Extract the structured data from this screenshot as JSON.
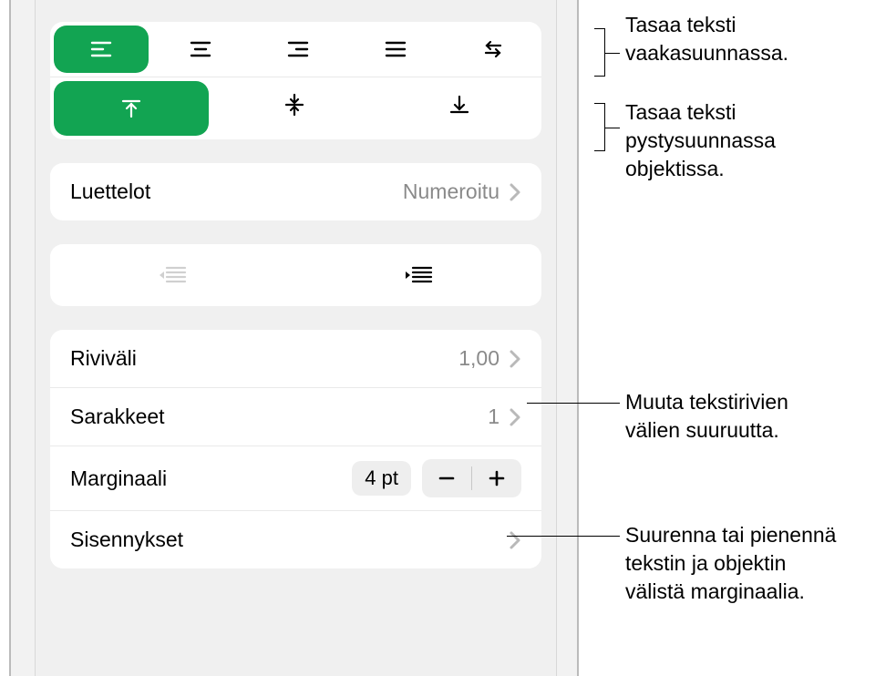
{
  "alignment": {
    "horizontal": {
      "selected": "left"
    },
    "vertical": {
      "selected": "top"
    }
  },
  "lists": {
    "label": "Luettelot",
    "value": "Numeroitu"
  },
  "lineSpacing": {
    "label": "Riviväli",
    "value": "1,00"
  },
  "columns": {
    "label": "Sarakkeet",
    "value": "1"
  },
  "margin": {
    "label": "Marginaali",
    "value": "4 pt"
  },
  "indents": {
    "label": "Sisennykset"
  },
  "callouts": {
    "h_align": "Tasaa teksti vaakasuunnassa.",
    "v_align": "Tasaa teksti pystysuunnassa objektissa.",
    "line_spacing": "Muuta tekstirivien välien suuruutta.",
    "margin": "Suurenna tai pienennä tekstin ja objektin välistä marginaalia."
  }
}
